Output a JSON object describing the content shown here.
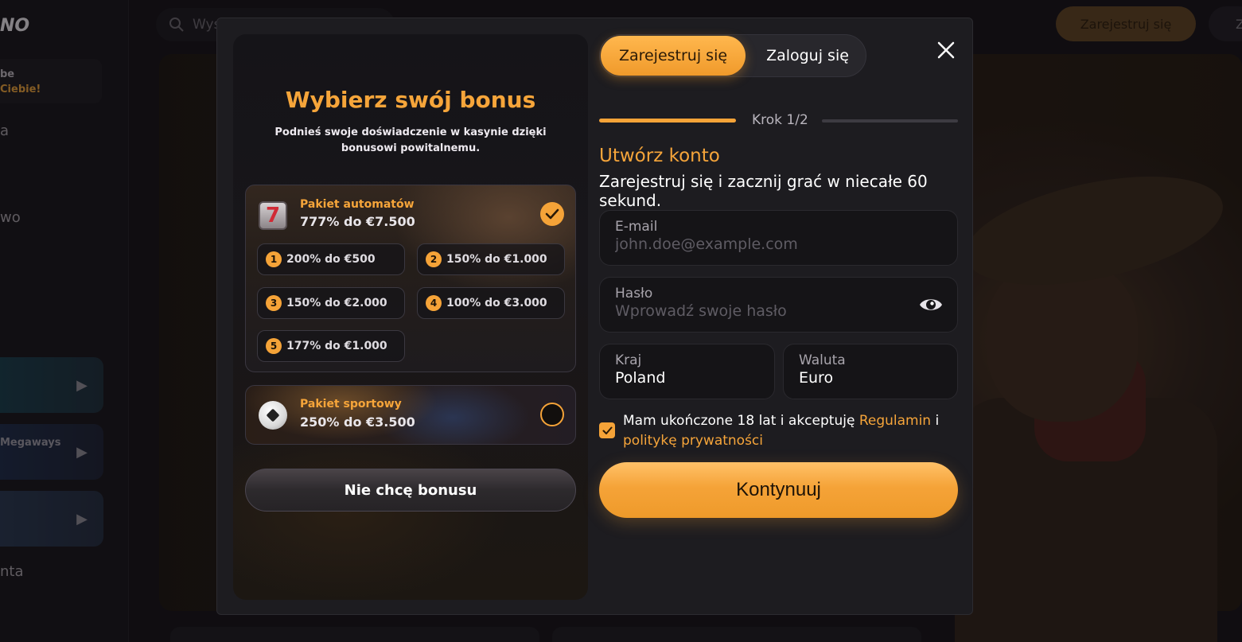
{
  "background": {
    "logo_top": "",
    "logo": "NO",
    "promo_line1": "be",
    "promo_line2": "Ciebie!",
    "nav_item_1": "a",
    "nav_item_2": "wo",
    "nav_item_3": "nta",
    "card_label_megaways": "Megaways",
    "search_placeholder": "Wys",
    "register_button": "Zarejestruj się",
    "login_button": "Z"
  },
  "modal": {
    "bonus": {
      "title": "Wybierz swój bonus",
      "subtitle": "Podnieś swoje doświadczenie w kasynie dzięki bonusowi powitalnemu.",
      "slots_package": {
        "name": "Pakiet automatów",
        "value": "777% do €7.500",
        "selected": true,
        "tiers": [
          {
            "num": "1",
            "label": "200% do €500"
          },
          {
            "num": "2",
            "label": "150% do €1.000"
          },
          {
            "num": "3",
            "label": "150% do €2.000"
          },
          {
            "num": "4",
            "label": "100% do €3.000"
          },
          {
            "num": "5",
            "label": "177% do €1.000"
          }
        ]
      },
      "sport_package": {
        "name": "Pakiet sportowy",
        "value": "250% do €3.500",
        "selected": false
      },
      "no_bonus_button": "Nie chcę bonusu"
    },
    "tabs": {
      "register": "Zarejestruj się",
      "login": "Zaloguj się"
    },
    "step": {
      "label": "Krok 1/2",
      "progress": 0.5
    },
    "form": {
      "title": "Utwórz konto",
      "subtitle": "Zarejestruj się i zacznij grać w niecałe 60 sekund.",
      "email_label": "E-mail",
      "email_placeholder": "john.doe@example.com",
      "password_label": "Hasło",
      "password_placeholder": "Wprowadź swoje hasło",
      "country_label": "Kraj",
      "country_value": "Poland",
      "currency_label": "Waluta",
      "currency_value": "Euro",
      "terms_text_1": "Mam ukończone 18 lat i akceptuję",
      "terms_link_1": "Regulamin",
      "terms_text_2": "i",
      "terms_link_2": "politykę prywatności",
      "terms_checked": true,
      "continue_button": "Kontynuuj"
    }
  },
  "colors": {
    "accent": "#f5a338",
    "modal_bg": "#1d1c20",
    "field_bg": "#151417"
  }
}
